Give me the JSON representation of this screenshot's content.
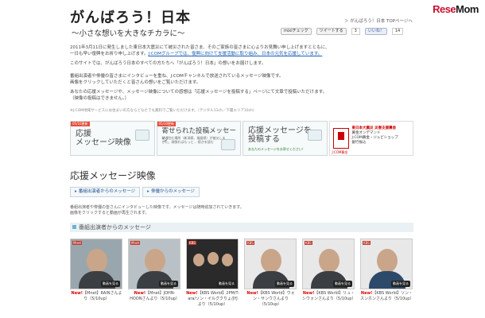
{
  "brand": {
    "name_red": "Rese",
    "name_black": "Mom",
    "sub": ""
  },
  "header": {
    "title": "がんばろう！日本",
    "title_mark": "本",
    "subtitle": "～小さな想いを大きなチカラに～",
    "top_links": "＞ がんばろう！日本 TOPページへ"
  },
  "social": {
    "mixi_label": "mixiチェック",
    "tweet_label": "ツイートする",
    "tweet_count": "3",
    "like_label": "いいね！",
    "like_count": "14"
  },
  "intro": {
    "line1": "2011年3月11日に発生しました東日本大震災にて被災された皆さま、そのご家族の皆さまに心よりお見舞い申し上げますとともに、",
    "line2": "一日も早い復興をお祈り申し上げます。",
    "line2_link": "J:COMグループでは、復興に向けて支援活動に取り組み、日本の元気を応援しています。",
    "line3": "このサイトでは、がんばろう日本のすべての方たちへ「がんばろう！日本」の想いをお届けします。",
    "line4": "番組出演者や俳優の皆さまにインタビューを重ね、J:COMチャンネルで放送されているメッセージ映像です。",
    "line5": "画像をクリックしていただくと皆さんの想いをご覧いただけます。",
    "line6": "あなたの応援メッセージや、メッセージ映像についての感想は「応援メッセージを投稿する」ページにて文章で投稿いただけます。",
    "line7": "（映像の投稿はできません。）",
    "note": "※J:COM地域サービスにお住まいの方ならどなたでも無料でご覧いただけます。（テジタル11ch／下層エリア10ch）"
  },
  "cards": [
    {
      "tag": "05/10更新",
      "head": "応援\nメッセージ映像",
      "desc": "",
      "icon": "video-icon"
    },
    {
      "tag": "05/10更新",
      "head": "寄せられた投稿メッセージ",
      "desc": "私の住む場所（新潟県、福島県）が被災しました。頑張ればもっと… 続きを読む",
      "icon": "message-icon"
    },
    {
      "tag": "",
      "head": "応援メッセージを\n投稿する",
      "desc": "あなたのメッセージをお寄せください！",
      "icon": "post-icon"
    },
    {
      "tag": "",
      "head": "",
      "jtitle": "東日本大震災 災害支援募金",
      "jtext": "募金オンデマンド\nJ:COM募金・ジュピショップ\n銀行振込",
      "logo_text": "J:COM募金",
      "icon": "jcom-logo-icon"
    }
  ],
  "section": {
    "title": "応援メッセージ映像",
    "tabs": [
      {
        "label": "番組出演者からのメッセージ"
      },
      {
        "label": "俳優からのメッセージ"
      }
    ],
    "desc1": "番組出演者や俳優の皆さんにインタビューした映像です。メッセージは随時追加されていきます。",
    "desc2": "画像をクリックすると動画が再生されます。",
    "subheading": "番組出演者からのメッセージ"
  },
  "thumbs": [
    {
      "channel": "Mnet",
      "new": "New!",
      "caption": "【Mnet】RAINさんより（5/10up）",
      "play": "動画を見る"
    },
    {
      "channel": "Mnet",
      "new": "New!",
      "caption": "【Mnet】JOHN-HOONさんより（5/10up）",
      "play": "動画を見る"
    },
    {
      "channel": "KBS",
      "new": "New!",
      "caption": "【KBS World】2PM/T-ara/ソン・イルグクりょ/JYJより（5/10up）",
      "play": "動画を見る"
    },
    {
      "channel": "KBS",
      "new": "New!",
      "caption": "【KBS World】ウォン・サンウさんより（5/10up）",
      "play": "動画を見る"
    },
    {
      "channel": "KBS",
      "new": "New!",
      "caption": "【KBS World】リュ・シウォンさんより（5/10up）",
      "play": "動画を見る"
    },
    {
      "channel": "KBS",
      "new": "New!",
      "caption": "【KBS World】ソン・スンホンさんより（5/10up）",
      "play": "動画を見る"
    }
  ]
}
